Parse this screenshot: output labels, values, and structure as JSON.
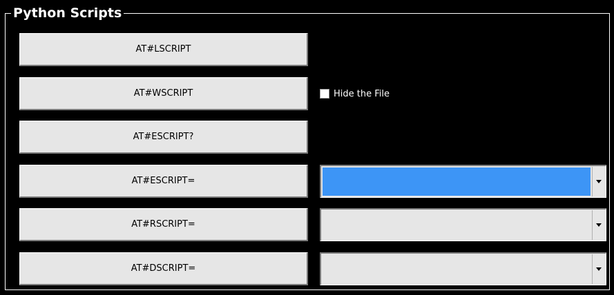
{
  "group": {
    "title": "Python Scripts"
  },
  "buttons": [
    {
      "label": "AT#LSCRIPT"
    },
    {
      "label": "AT#WSCRIPT"
    },
    {
      "label": "AT#ESCRIPT?"
    },
    {
      "label": "AT#ESCRIPT="
    },
    {
      "label": "AT#RSCRIPT="
    },
    {
      "label": "AT#DSCRIPT="
    }
  ],
  "hide_file": {
    "label": "Hide the File",
    "checked": false
  },
  "combos": [
    {
      "value": "",
      "state": "selected"
    },
    {
      "value": "",
      "state": "normal"
    },
    {
      "value": "",
      "state": "normal"
    }
  ],
  "colors": {
    "background": "#000000",
    "button_face": "#e6e6e6",
    "selection": "#3d95f6",
    "text_light": "#ffffff"
  }
}
